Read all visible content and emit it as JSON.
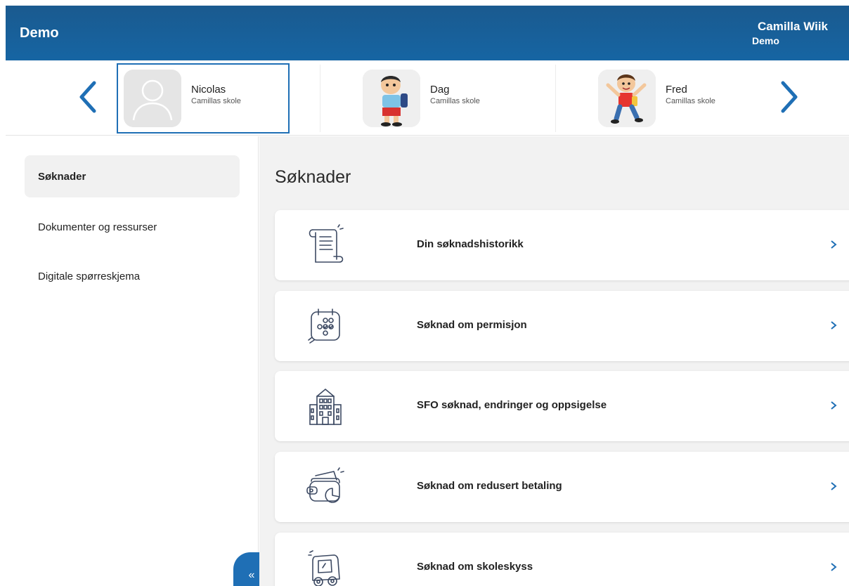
{
  "header": {
    "title": "Demo",
    "user_name": "Camilla Wiik",
    "user_org": "Demo"
  },
  "children": [
    {
      "name": "Nicolas",
      "school": "Camillas skole",
      "avatar": "placeholder-person-icon",
      "selected": true
    },
    {
      "name": "Dag",
      "school": "Camillas skole",
      "avatar": "boy-with-backpack-avatar"
    },
    {
      "name": "Fred",
      "school": "Camillas skole",
      "avatar": "boy-waving-avatar"
    }
  ],
  "sidebar": {
    "items": [
      {
        "label": "Søknader",
        "active": true
      },
      {
        "label": "Dokumenter og ressurser"
      },
      {
        "label": "Digitale spørreskjema"
      }
    ],
    "collapse_label": "«"
  },
  "main": {
    "title": "Søknader",
    "cards": [
      {
        "label": "Din søknadshistorikk",
        "icon": "scroll-document-icon"
      },
      {
        "label": "Søknad om permisjon",
        "icon": "calendar-checks-icon"
      },
      {
        "label": "SFO søknad, endringer og oppsigelse",
        "icon": "school-building-icon"
      },
      {
        "label": "Søknad om redusert betaling",
        "icon": "wallet-icon"
      },
      {
        "label": "Søknad om skoleskyss",
        "icon": "bus-icon"
      }
    ]
  },
  "colors": {
    "header": "#1665a3",
    "accent": "#1f6fb5",
    "main_bg": "#f2f2f2"
  }
}
